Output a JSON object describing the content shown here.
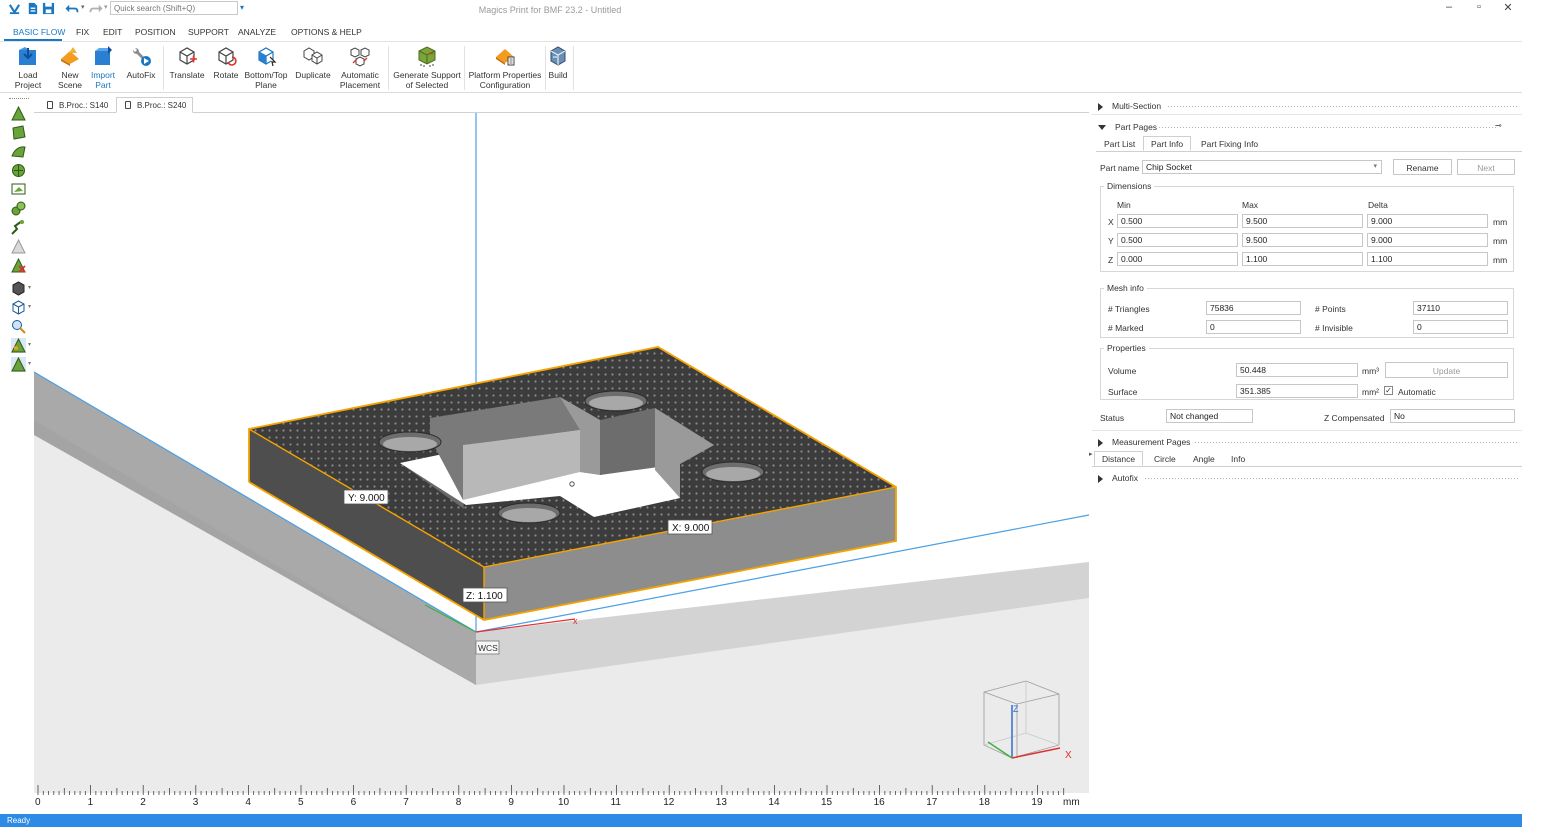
{
  "app": {
    "title": "Magics Print for BMF 23.2 - Untitled",
    "search_placeholder": "Quick search (Shift+Q)"
  },
  "menu": {
    "tabs": [
      "BASIC FLOW",
      "FIX",
      "EDIT",
      "POSITION",
      "SUPPORT",
      "ANALYZE",
      "OPTIONS & HELP"
    ],
    "active": "BASIC FLOW"
  },
  "ribbon": {
    "load_project": [
      "Load",
      "Project"
    ],
    "new_scene": [
      "New",
      "Scene"
    ],
    "import_part": [
      "Import",
      "Part"
    ],
    "autofix": "AutoFix",
    "translate": "Translate",
    "rotate": "Rotate",
    "bottom_top_plane": [
      "Bottom/Top",
      "Plane"
    ],
    "duplicate": "Duplicate",
    "automatic_placement": [
      "Automatic",
      "Placement"
    ],
    "generate_support": [
      "Generate Support",
      "of Selected"
    ],
    "platform_properties": [
      "Platform Properties",
      "Configuration"
    ],
    "build": "Build"
  },
  "doc_tabs": [
    "B.Proc.: S140",
    "B.Proc.: S240"
  ],
  "viewport": {
    "label_y": "Y: 9.000",
    "label_x": "X: 9.000",
    "label_z": "Z: 1.100",
    "wcs": "WCS",
    "axis_x": "x",
    "cube_x": "X",
    "cube_z": "Z"
  },
  "ruler": {
    "numbers": [
      "0",
      "1",
      "2",
      "3",
      "4",
      "5",
      "6",
      "7",
      "8",
      "9",
      "10",
      "11",
      "12",
      "13",
      "14",
      "15",
      "16",
      "17",
      "18",
      "19"
    ],
    "unit": "mm"
  },
  "panel": {
    "multi_section": "Multi-Section",
    "part_pages": "Part Pages",
    "part_tabs": [
      "Part List",
      "Part Info",
      "Part Fixing Info"
    ],
    "part_name_label": "Part name",
    "part_name_value": "Chip Socket",
    "rename": "Rename",
    "next": "Next",
    "dimensions": {
      "title": "Dimensions",
      "col_min": "Min",
      "col_max": "Max",
      "col_delta": "Delta",
      "rows": [
        {
          "axis": "X",
          "min": "0.500",
          "max": "9.500",
          "delta": "9.000",
          "unit": "mm"
        },
        {
          "axis": "Y",
          "min": "0.500",
          "max": "9.500",
          "delta": "9.000",
          "unit": "mm"
        },
        {
          "axis": "Z",
          "min": "0.000",
          "max": "1.100",
          "delta": "1.100",
          "unit": "mm"
        }
      ]
    },
    "mesh": {
      "title": "Mesh info",
      "triangles_label": "# Triangles",
      "triangles": "75836",
      "points_label": "# Points",
      "points": "37110",
      "marked_label": "# Marked",
      "marked": "0",
      "invisible_label": "# Invisible",
      "invisible": "0"
    },
    "properties": {
      "title": "Properties",
      "volume_label": "Volume",
      "volume": "50.448",
      "volume_unit": "mm³",
      "update": "Update",
      "surface_label": "Surface",
      "surface": "351.385",
      "surface_unit": "mm²",
      "automatic": "Automatic"
    },
    "status_label": "Status",
    "status_value": "Not changed",
    "zcomp_label": "Z Compensated",
    "zcomp_value": "No",
    "measurement_pages": "Measurement Pages",
    "measure_tabs": [
      "Distance",
      "Circle",
      "Angle",
      "Info"
    ],
    "autofix": "Autofix"
  },
  "status": "Ready",
  "colors": {
    "accent": "#1a78c2",
    "statusbar": "#2d8ae5",
    "selection_outline": "#f5a300",
    "part_body": "#505050"
  }
}
